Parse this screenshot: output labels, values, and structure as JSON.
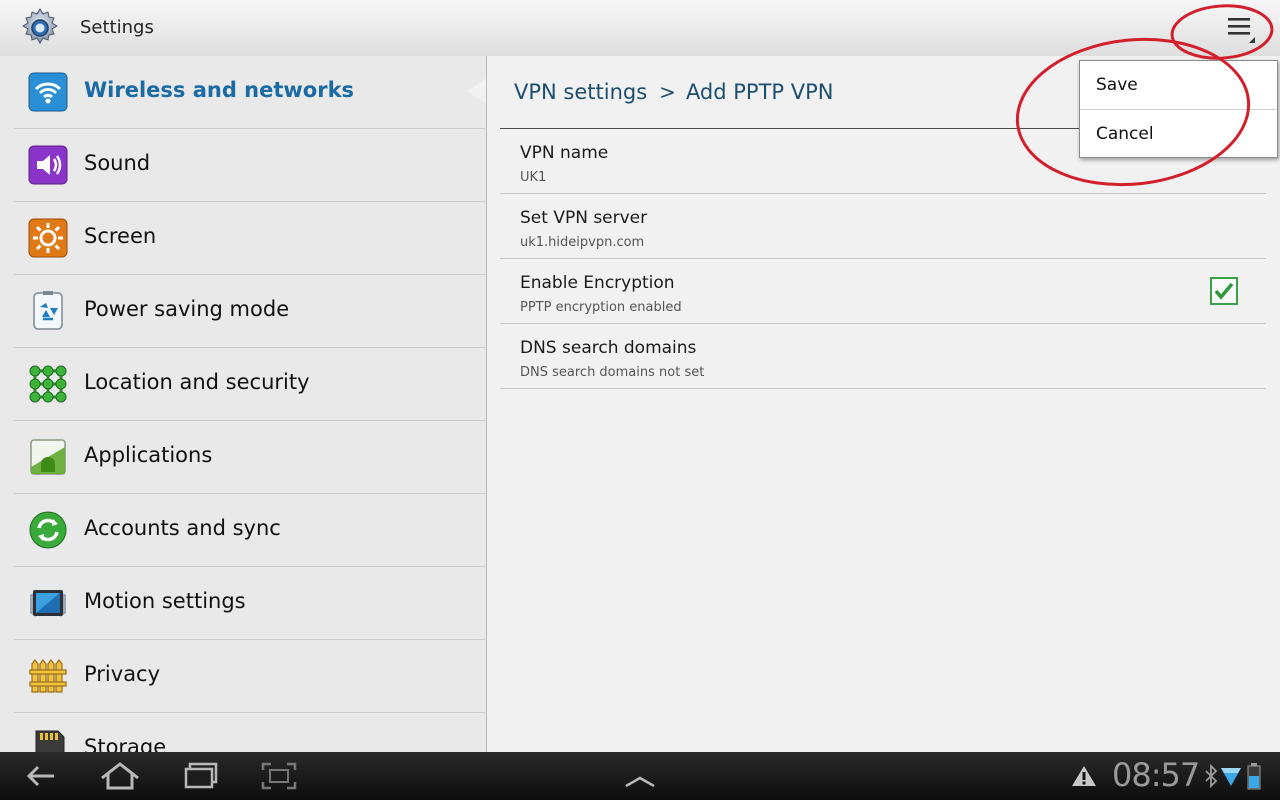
{
  "app": {
    "title": "Settings",
    "icon": "gear-icon"
  },
  "categories": [
    {
      "label": "Wireless and networks",
      "icon": "wifi-icon",
      "selected": true
    },
    {
      "label": "Sound",
      "icon": "speaker-icon"
    },
    {
      "label": "Screen",
      "icon": "brightness-icon"
    },
    {
      "label": "Power saving mode",
      "icon": "recycle-icon"
    },
    {
      "label": "Location and security",
      "icon": "lock-pattern-icon"
    },
    {
      "label": "Applications",
      "icon": "android-icon"
    },
    {
      "label": "Accounts and sync",
      "icon": "sync-icon"
    },
    {
      "label": "Motion settings",
      "icon": "tablet-motion-icon"
    },
    {
      "label": "Privacy",
      "icon": "fence-icon"
    },
    {
      "label": "Storage",
      "icon": "sd-card-icon"
    }
  ],
  "breadcrumb": {
    "parent": "VPN settings",
    "separator": ">",
    "current": "Add PPTP VPN"
  },
  "preferences": [
    {
      "title": "VPN name",
      "summary": "UK1"
    },
    {
      "title": "Set VPN server",
      "summary": "uk1.hideipvpn.com"
    },
    {
      "title": "Enable Encryption",
      "summary": "PPTP encryption enabled",
      "checked": true
    },
    {
      "title": "DNS search domains",
      "summary": "DNS search domains not set"
    }
  ],
  "menu": {
    "items": [
      "Save",
      "Cancel"
    ]
  },
  "status": {
    "time": "08:57"
  },
  "colors": {
    "accent": "#1a6aa3",
    "annotation": "#d21f2b",
    "checkbox_check": "#2a9a3a"
  }
}
